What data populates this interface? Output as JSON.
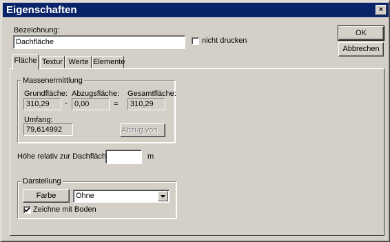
{
  "window": {
    "title": "Eigenschaften",
    "close_glyph": "×"
  },
  "bezeichnung": {
    "label": "Bezeichnung:",
    "value": "Dachfläche"
  },
  "nicht_drucken": {
    "label": "nicht drucken",
    "checked": false
  },
  "buttons": {
    "ok": "OK",
    "cancel": "Abbrechen"
  },
  "tabs": [
    {
      "label": "Fläche",
      "active": true
    },
    {
      "label": "Textur",
      "active": false
    },
    {
      "label": "Werte",
      "active": false
    },
    {
      "label": "Elemente",
      "active": false
    }
  ],
  "massenermittlung": {
    "title": "Massenermittlung",
    "grundflaeche": {
      "label": "Grundfläche:",
      "value": "310,29"
    },
    "minus_sign": "-",
    "abzugsflaeche": {
      "label": "Abzugsfläche:",
      "value": "0,00"
    },
    "equals_sign": "=",
    "gesamtflaeche": {
      "label": "Gesamtfläche:",
      "value": "310,29"
    },
    "umfang": {
      "label": "Umfang:",
      "value": "79,614992"
    },
    "abzug_button": "Abzug von..."
  },
  "hoehe": {
    "label": "Höhe relativ zur Dachfläche:",
    "value": "",
    "unit": "m"
  },
  "darstellung": {
    "title": "Darstellung",
    "farbe_button": "Farbe",
    "combo_value": "Ohne",
    "zeichne_mit_boden": {
      "label": "Zeichne mit Boden",
      "checked": true
    }
  }
}
